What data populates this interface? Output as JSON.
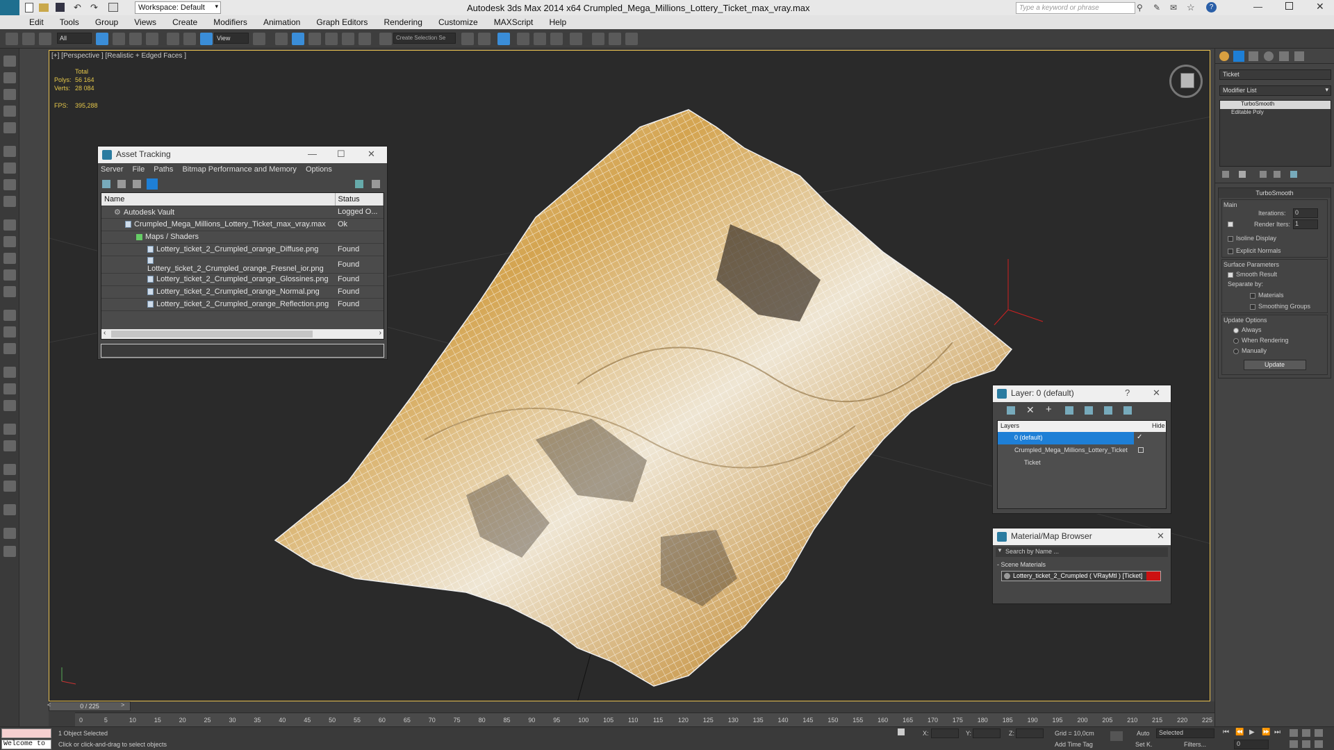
{
  "app": {
    "title": "Autodesk 3ds Max  2014 x64     Crumpled_Mega_Millions_Lottery_Ticket_max_vray.max",
    "workspace": "Workspace: Default",
    "search_placeholder": "Type a keyword or phrase"
  },
  "menu": [
    "Edit",
    "Tools",
    "Group",
    "Views",
    "Create",
    "Modifiers",
    "Animation",
    "Graph Editors",
    "Rendering",
    "Customize",
    "MAXScript",
    "Help"
  ],
  "toolbar": {
    "filter": "All",
    "ref_coord": "View",
    "selection_set": "Create Selection Se"
  },
  "viewport": {
    "label": "[+] [Perspective ] [Realistic + Edged Faces ]",
    "stats_header": "Total",
    "polys_label": "Polys:",
    "polys_value": "56 164",
    "verts_label": "Verts:",
    "verts_value": "28 084",
    "fps_label": "FPS:",
    "fps_value": "395,288"
  },
  "asset_tracking": {
    "title": "Asset Tracking",
    "menu": [
      "Server",
      "File",
      "Paths",
      "Bitmap Performance and Memory",
      "Options"
    ],
    "col_name": "Name",
    "col_status": "Status",
    "rows": [
      {
        "name": "Autodesk Vault",
        "status": "Logged O..."
      },
      {
        "name": "Crumpled_Mega_Millions_Lottery_Ticket_max_vray.max",
        "status": "Ok"
      },
      {
        "name": "Maps / Shaders",
        "status": ""
      },
      {
        "name": "Lottery_ticket_2_Crumpled_orange_Diffuse.png",
        "status": "Found"
      },
      {
        "name": "Lottery_ticket_2_Crumpled_orange_Fresnel_ior.png",
        "status": "Found"
      },
      {
        "name": "Lottery_ticket_2_Crumpled_orange_Glossines.png",
        "status": "Found"
      },
      {
        "name": "Lottery_ticket_2_Crumpled_orange_Normal.png",
        "status": "Found"
      },
      {
        "name": "Lottery_ticket_2_Crumpled_orange_Reflection.png",
        "status": "Found"
      }
    ]
  },
  "layer_dialog": {
    "title": "Layer: 0 (default)",
    "col_layers": "Layers",
    "col_hide": "Hide",
    "items": [
      "0 (default)",
      "Crumpled_Mega_Millions_Lottery_Ticket",
      "Ticket"
    ]
  },
  "material_browser": {
    "title": "Material/Map Browser",
    "search_placeholder": "Search by Name ...",
    "group": "- Scene Materials",
    "material": "Lottery_ticket_2_Crumpled  ( VRayMtl )  [Ticket]"
  },
  "command_panel": {
    "object_name": "Ticket",
    "modifier_list": "Modifier List",
    "stack": [
      "TurboSmooth",
      "Editable Poly"
    ],
    "rollout_title": "TurboSmooth",
    "main_label": "Main",
    "iterations_label": "Iterations:",
    "iterations_value": "0",
    "render_iters_label": "Render Iters:",
    "render_iters_value": "1",
    "isoline": "Isoline Display",
    "explicit_normals": "Explicit Normals",
    "surface_params": "Surface Parameters",
    "smooth_result": "Smooth Result",
    "separate_by": "Separate by:",
    "materials": "Materials",
    "smoothing_groups": "Smoothing Groups",
    "update_options": "Update Options",
    "always": "Always",
    "when_rendering": "When Rendering",
    "manually": "Manually",
    "update_button": "Update"
  },
  "timeline": {
    "frame": "0 / 225",
    "ticks": [
      "0",
      "5",
      "10",
      "15",
      "20",
      "25",
      "30",
      "35",
      "40",
      "45",
      "50",
      "55",
      "60",
      "65",
      "70",
      "75",
      "80",
      "85",
      "90",
      "95",
      "100",
      "105",
      "110",
      "115",
      "120",
      "125",
      "130",
      "135",
      "140",
      "145",
      "150",
      "155",
      "160",
      "165",
      "170",
      "175",
      "180",
      "185",
      "190",
      "195",
      "200",
      "205",
      "210",
      "215",
      "220",
      "225"
    ]
  },
  "status": {
    "welcome": "Welcome to",
    "selected": "1 Object Selected",
    "hint": "Click or click-and-drag to select objects",
    "x_label": "X:",
    "y_label": "Y:",
    "z_label": "Z:",
    "grid": "Grid = 10,0cm",
    "add_time_tag": "Add Time Tag",
    "auto": "Auto",
    "set_k": "Set K.",
    "selected_mode": "Selected",
    "filters": "Filters...",
    "frame_field": "0"
  },
  "colors": {
    "accent_blue": "#1e7fd6",
    "viewport_border": "#e8c050",
    "stats_yellow": "#e6c84a",
    "material_red": "#cc1111"
  }
}
